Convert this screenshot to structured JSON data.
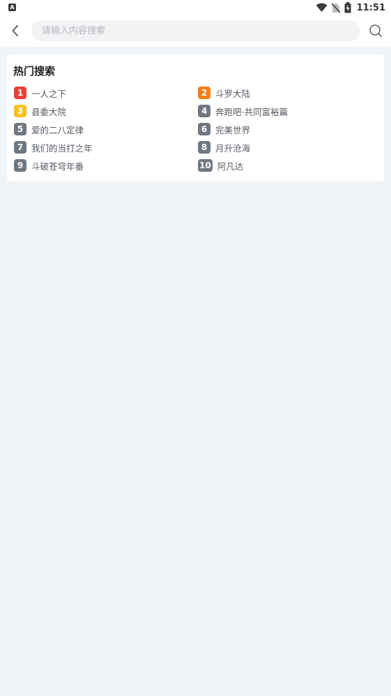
{
  "status": {
    "left_badge": "A",
    "time": "11:51"
  },
  "search": {
    "placeholder": "请输入内容搜索"
  },
  "hot": {
    "title": "热门搜索",
    "items": [
      {
        "rank": "1",
        "label": "一人之下",
        "color": "#e94036"
      },
      {
        "rank": "2",
        "label": "斗罗大陆",
        "color": "#f57f17"
      },
      {
        "rank": "3",
        "label": "县委大院",
        "color": "#f6c21c"
      },
      {
        "rank": "4",
        "label": "奔跑吧·共同富裕篇",
        "color": "#6f7780"
      },
      {
        "rank": "5",
        "label": "爱的二八定律",
        "color": "#6f7780"
      },
      {
        "rank": "6",
        "label": "完美世界",
        "color": "#6f7780"
      },
      {
        "rank": "7",
        "label": "我们的当打之年",
        "color": "#6f7780"
      },
      {
        "rank": "8",
        "label": "月升沧海",
        "color": "#6f7780"
      },
      {
        "rank": "9",
        "label": "斗破苍穹年番",
        "color": "#6f7780"
      },
      {
        "rank": "10",
        "label": "阿凡达",
        "color": "#6f7780"
      }
    ]
  },
  "icons": {
    "back": "chevron-left-icon",
    "search": "search-icon",
    "wifi": "wifi-icon",
    "sim": "no-sim-icon",
    "battery": "battery-charging-icon"
  }
}
